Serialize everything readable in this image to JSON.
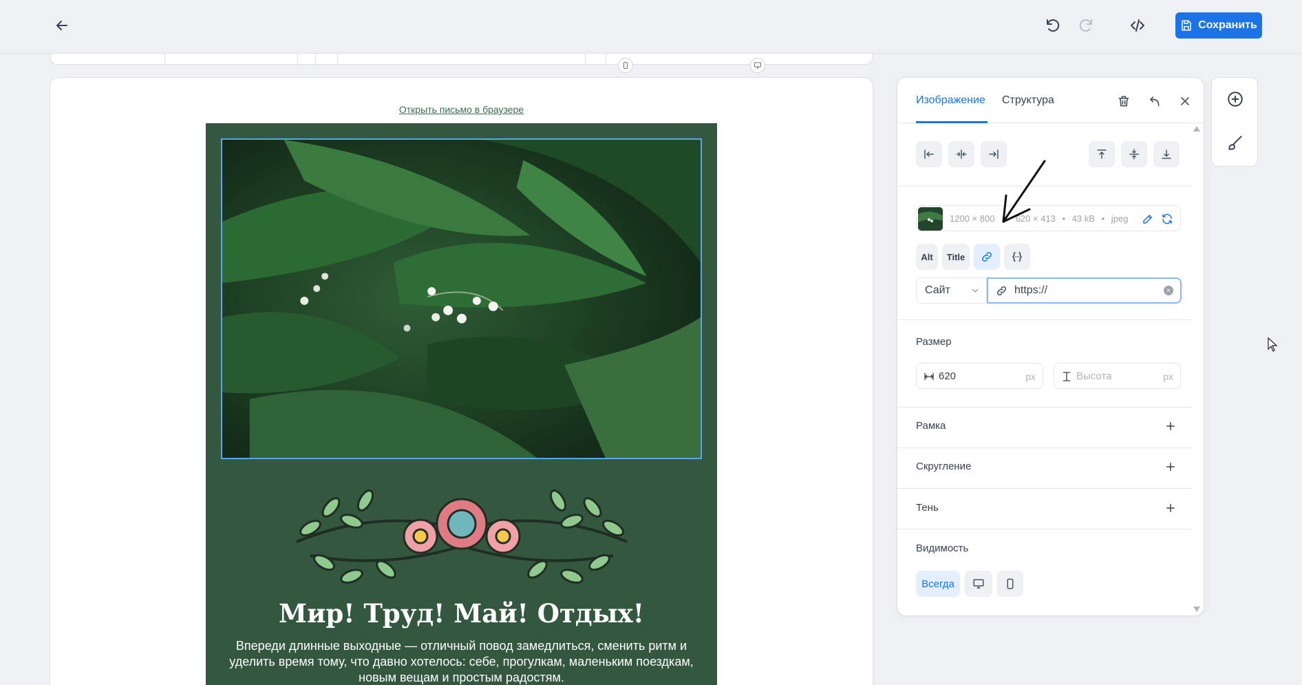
{
  "toolbar": {
    "save_label": "Сохранить",
    "back_icon": "arrow-left-icon",
    "undo_icon": "undo-icon",
    "redo_icon": "redo-icon",
    "code_icon": "code-icon"
  },
  "canvas": {
    "browser_link": "Открыть письмо в браузере",
    "email": {
      "title": "Мир! Труд! Май! Отдых!",
      "body": "Впереди длинные выходные — отличный повод замедлиться, сменить ритм и уделить время тому, что давно хотелось: себе, прогулкам, маленьким поездкам, новым вещам и простым радостям.",
      "bg_color": "#33573f"
    }
  },
  "panel": {
    "tabs": [
      {
        "label": "Изображение",
        "active": true
      },
      {
        "label": "Структура",
        "active": false
      }
    ],
    "file": {
      "original": "1200 × 800",
      "arrow": "→",
      "rendered": "620 × 413",
      "size": "43 kB",
      "format": "jpeg"
    },
    "pills": {
      "alt": "Alt",
      "title": "Title"
    },
    "link": {
      "type": "Сайт",
      "url": "https://"
    },
    "size": {
      "label": "Размер",
      "width_value": "620",
      "width_unit": "px",
      "height_placeholder": "Высота",
      "height_unit": "px"
    },
    "sections": {
      "border": "Рамка",
      "radius": "Скругление",
      "shadow": "Тень"
    },
    "visibility": {
      "label": "Видимость",
      "always": "Всегда"
    }
  },
  "colors": {
    "accent": "#1a73e8",
    "email_bg": "#33573f"
  }
}
